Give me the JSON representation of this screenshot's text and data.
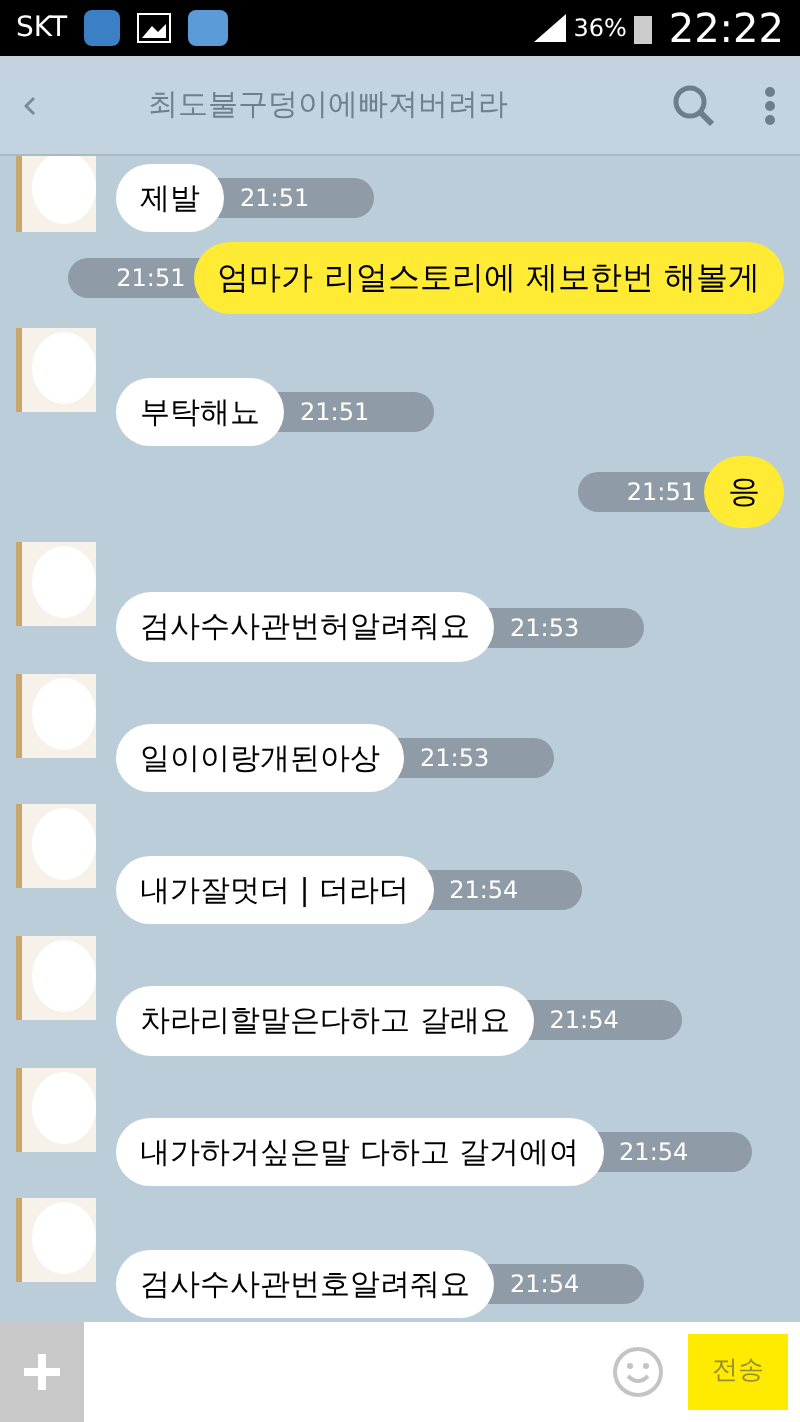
{
  "status_bar": {
    "carrier": "SKT",
    "battery": "36%",
    "time": "22:22"
  },
  "header": {
    "title": "최도불구덩이에빠져버려라"
  },
  "messages": [
    {
      "kind": "incoming",
      "text": "제발",
      "time": "21:51"
    },
    {
      "kind": "outgoing",
      "text": "엄마가 리얼스토리에 제보한번 해볼게",
      "time": "21:51"
    },
    {
      "kind": "incoming",
      "text": "부탁해뇨",
      "time": "21:51"
    },
    {
      "kind": "outgoing",
      "text": "응",
      "time": "21:51"
    },
    {
      "kind": "incoming",
      "text": "검사수사관번허알려줘요",
      "time": "21:53"
    },
    {
      "kind": "incoming",
      "text": "일이이랑개된아상",
      "time": "21:53"
    },
    {
      "kind": "incoming",
      "text": "내가잘멋더 | 더라더",
      "time": "21:54"
    },
    {
      "kind": "incoming",
      "text": "차라리할말은다하고 갈래요",
      "time": "21:54"
    },
    {
      "kind": "incoming",
      "text": "내가하거싶은말 다하고 갈거에여",
      "time": "21:54"
    },
    {
      "kind": "incoming",
      "text": "검사수사관번호알려줘요",
      "time": "21:54"
    }
  ],
  "composer": {
    "send": "전송"
  }
}
